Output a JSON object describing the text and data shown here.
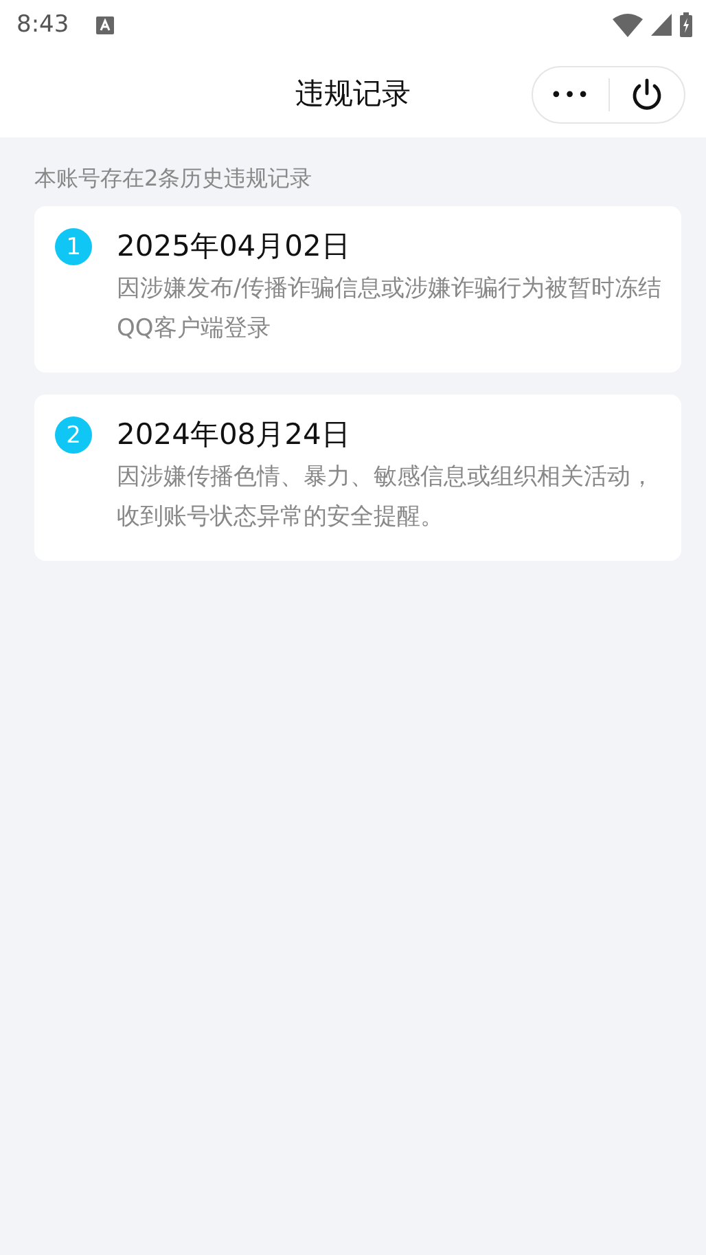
{
  "status_bar": {
    "time": "8:43"
  },
  "header": {
    "title": "违规记录",
    "more_button": "•••"
  },
  "summary": "本账号存在2条历史违规记录",
  "records": [
    {
      "index": "1",
      "date": "2025年04月02日",
      "description": "因涉嫌发布/传播诈骗信息或涉嫌诈骗行为被暂时冻结QQ客户端登录"
    },
    {
      "index": "2",
      "date": "2024年08月24日",
      "description": "因涉嫌传播色情、暴力、敏感信息或组织相关活动，收到账号状态异常的安全提醒。"
    }
  ]
}
